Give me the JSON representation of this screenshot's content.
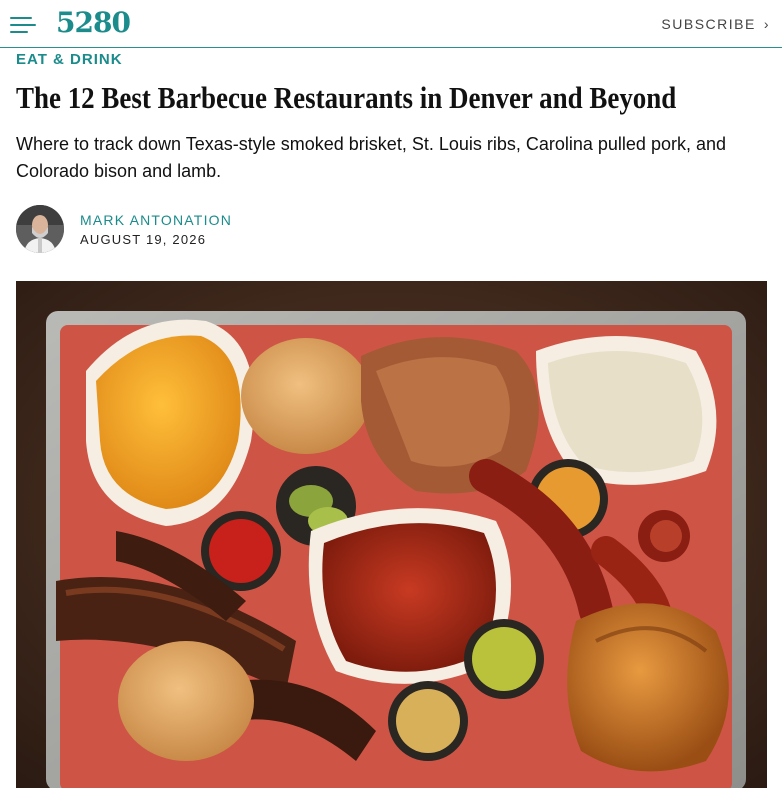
{
  "header": {
    "logo": "5280",
    "menu_icon": "hamburger-menu-icon",
    "subscribe_label": "SUBSCRIBE",
    "subscribe_icon": "chevron-right-icon",
    "accent": "#1b8b8b"
  },
  "article": {
    "section": "EAT & DRINK",
    "title": "The 12 Best Barbecue Restaurants in Denver and Beyond",
    "dek": "Where to track down Texas-style smoked brisket, St. Louis ribs, Carolina pulled pork, and Colorado bison and lamb.",
    "author": "MARK ANTONATION",
    "date": "AUGUST 19, 2026"
  }
}
